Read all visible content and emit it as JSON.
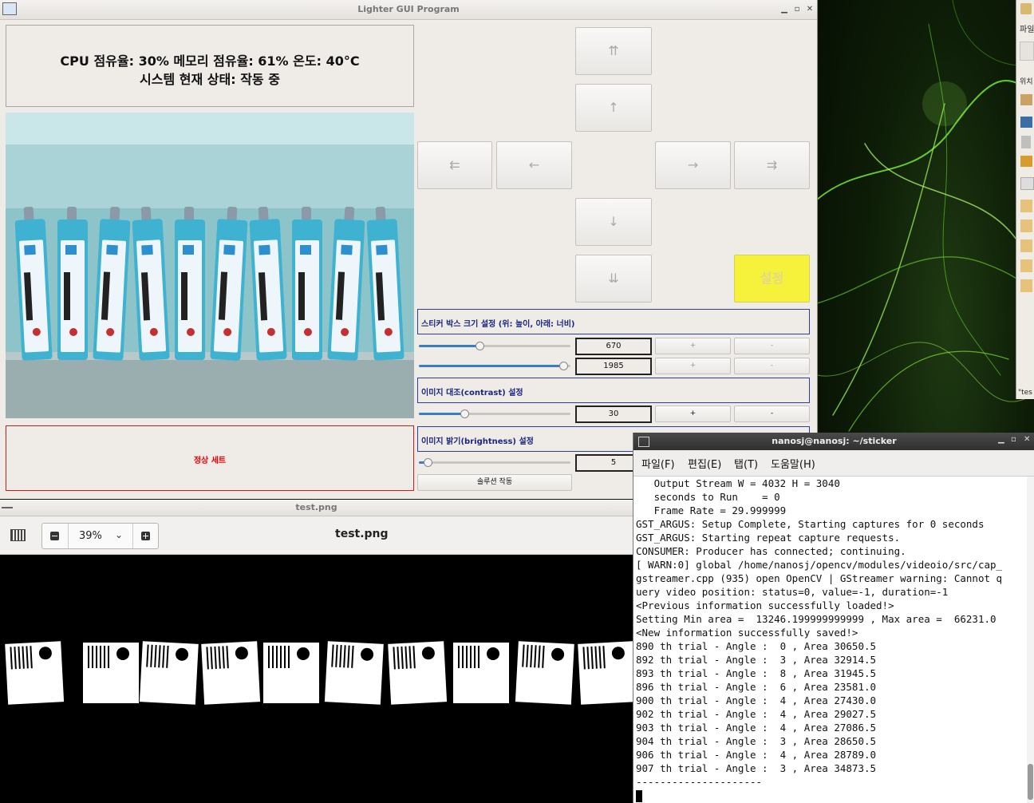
{
  "app": {
    "title": "Lighter GUI Program",
    "status_line1": "CPU 점유율: 30%  메모리 점유율: 61%  온도: 40°C",
    "status_line2": "시스템 현재 상태: 작동 중",
    "message": "정상 세트",
    "pad": {
      "up_fast": "⇈",
      "up": "↑",
      "left_fast": "⇇",
      "left": "←",
      "right": "→",
      "right_fast": "⇉",
      "down": "↓",
      "down_fast": "⇊",
      "set_label": "설정"
    },
    "groups": {
      "sticker_size": "스티커 박스 크기 설정 (위: 높이, 아래: 너비)",
      "contrast": "이미지 대조(contrast) 설정",
      "brightness": "이미지 밝기(brightness) 설정"
    },
    "controls": {
      "height_value": "670",
      "width_value": "1985",
      "contrast_value": "30",
      "brightness_value": "5",
      "plus": "+",
      "minus": "-",
      "solution_label": "솔루션 작동"
    },
    "sliders": {
      "height_level": 0.4,
      "width_level": 0.95,
      "contrast_level": 0.3,
      "brightness_level": 0.06
    }
  },
  "viewer": {
    "title": "test.png",
    "zoom": "39%",
    "filename": "test.png"
  },
  "terminal": {
    "title": "nanosj@nanosj: ~/sticker",
    "menu": [
      "파일(F)",
      "편집(E)",
      "탭(T)",
      "도움말(H)"
    ],
    "lines": [
      "   Output Stream W = 4032 H = 3040",
      "   seconds to Run    = 0",
      "   Frame Rate = 29.999999",
      "GST_ARGUS: Setup Complete, Starting captures for 0 seconds",
      "GST_ARGUS: Starting repeat capture requests.",
      "CONSUMER: Producer has connected; continuing.",
      "[ WARN:0] global /home/nanosj/opencv/modules/videoio/src/cap_",
      "gstreamer.cpp (935) open OpenCV | GStreamer warning: Cannot q",
      "uery video position: status=0, value=-1, duration=-1",
      "<Previous information successfully loaded!>",
      "Setting Min area =  13246.199999999999 , Max area =  66231.0",
      "<New information successfully saved!>",
      "890 th trial - Angle :  0 , Area 30650.5",
      "892 th trial - Angle :  3 , Area 32914.5",
      "893 th trial - Angle :  8 , Area 31945.5",
      "896 th trial - Angle :  6 , Area 23581.0",
      "900 th trial - Angle :  4 , Area 27430.0",
      "902 th trial - Angle :  4 , Area 29027.5",
      "903 th trial - Angle :  4 , Area 27086.5",
      "904 th trial - Angle :  3 , Area 28650.5",
      "906 th trial - Angle :  4 , Area 28789.0",
      "907 th trial - Angle :  3 , Area 34873.5",
      "---------------------"
    ]
  },
  "side_app": {
    "menu_fragment": "파일",
    "location_fragment": "위치",
    "tab_fragment": "\"tes"
  },
  "colors": {
    "set_button": "#f6f23c",
    "message_border": "#d21a1a",
    "group_border": "#2a3fa0",
    "slider_fill": "#3b7cc5"
  }
}
